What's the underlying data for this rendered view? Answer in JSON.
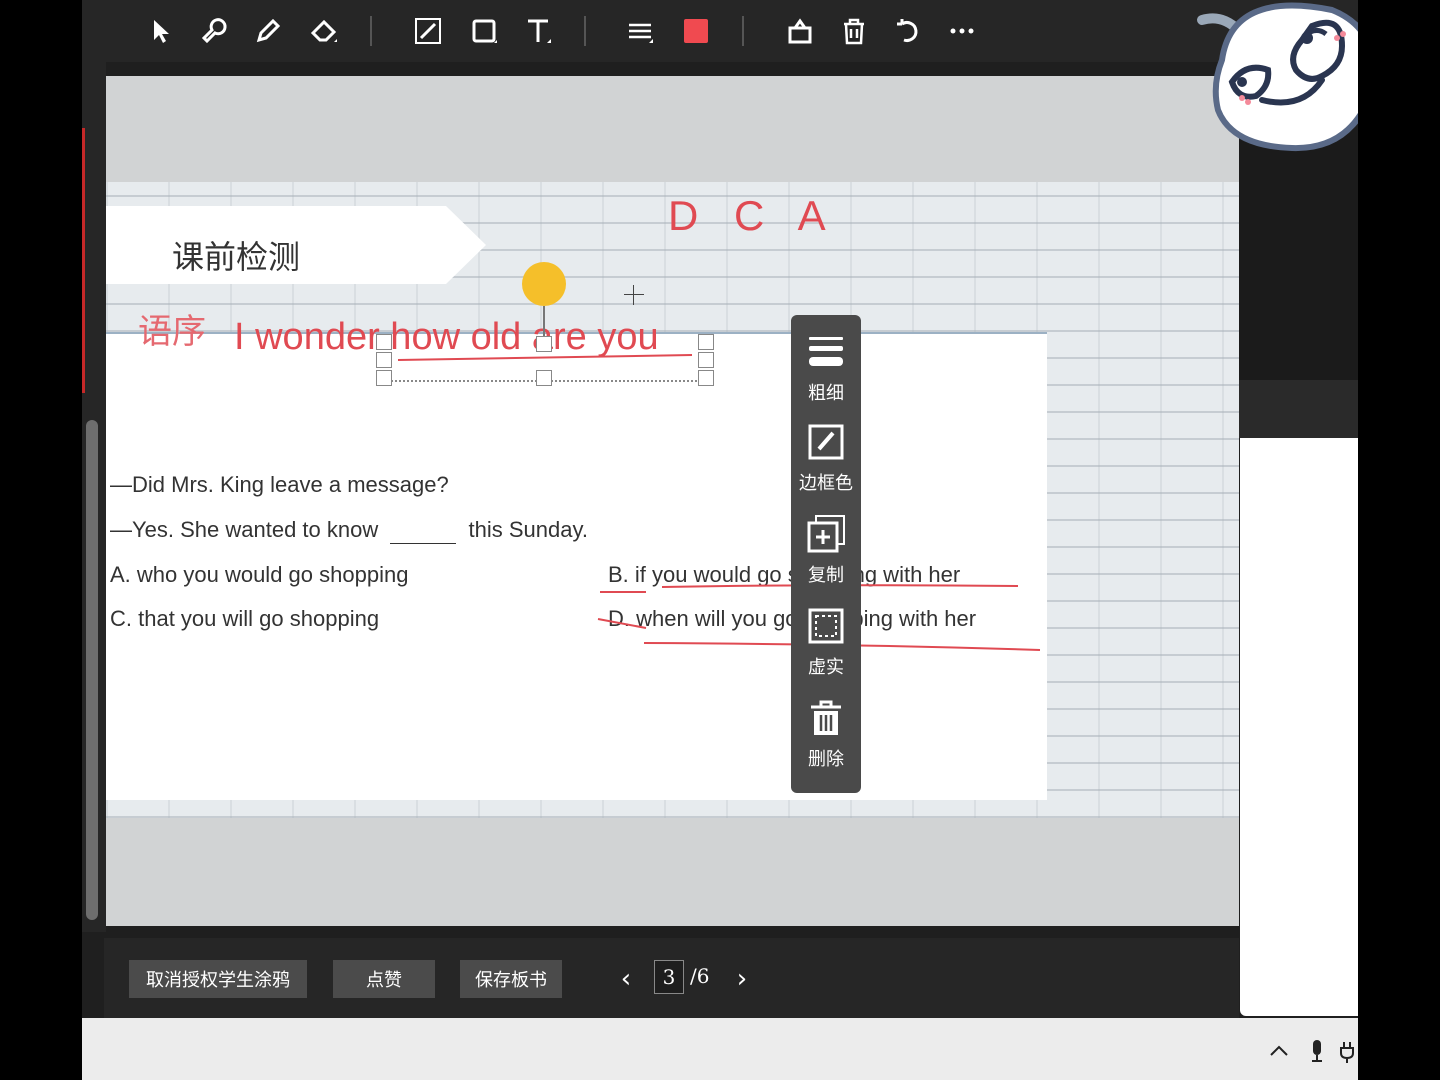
{
  "toolbar": {
    "tools": [
      "select-tool",
      "laser-pointer-tool",
      "pen-tool",
      "eraser-tool",
      "line-tool",
      "rectangle-tool",
      "text-tool",
      "line-weight-tool",
      "color-picker",
      "clear-board",
      "delete",
      "undo",
      "more"
    ],
    "pen_color": "#f04a50"
  },
  "slide": {
    "section_title": "课前检测",
    "annotation_top": "D C A",
    "annotation_chinese": "语序",
    "annotation_sentence": "I wonder how old are you",
    "question_line1": "—Did Mrs. King leave a message?",
    "question_line2_prefix": "—Yes. She wanted to know",
    "question_line2_suffix": "this Sunday.",
    "options": {
      "a": "A.  who you would go shopping",
      "b": "B.  if you would go shopping with her",
      "c": "C.  that you will go shopping",
      "d": "D.  when will you go shopping with her"
    }
  },
  "pen_panel": {
    "items": [
      {
        "label": "粗细",
        "icon": "line-weight-icon"
      },
      {
        "label": "边框色",
        "icon": "border-color-icon"
      },
      {
        "label": "复制",
        "icon": "copy-icon"
      },
      {
        "label": "虚实",
        "icon": "dashed-solid-icon"
      },
      {
        "label": "删除",
        "icon": "trash-icon"
      }
    ]
  },
  "bottom_bar": {
    "revoke_button": "取消授权学生涂鸦",
    "like_button": "点赞",
    "save_button": "保存板书",
    "current_page": "3",
    "total_pages": "/6",
    "prev_icon": "‹",
    "next_icon": "›"
  },
  "colors": {
    "annotation_red": "#e04a52",
    "toolbar_bg": "#262626",
    "board_bg": "#d1d3d4"
  }
}
